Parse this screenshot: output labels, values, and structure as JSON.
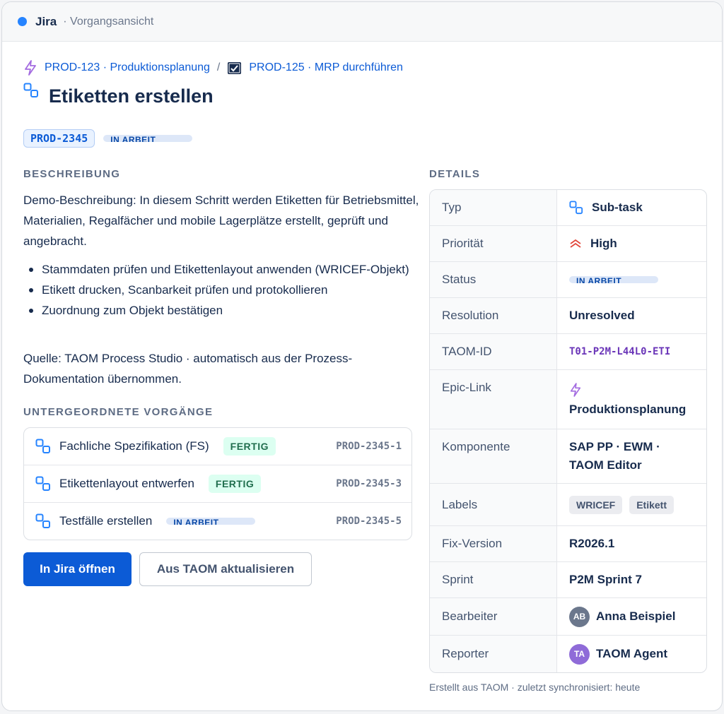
{
  "app": {
    "name": "Jira",
    "view": "· Vorgangsansicht"
  },
  "breadcrumb": {
    "epic": "PROD-123 · Produktionsplanung",
    "separator": "/",
    "parent": "PROD-125 · MRP durchführen"
  },
  "issue": {
    "title": "Etiketten erstellen",
    "key": "PROD-2345",
    "status": "IN ARBEIT"
  },
  "description": {
    "heading": "BESCHREIBUNG",
    "intro": "Demo-Beschreibung: In diesem Schritt werden Etiketten für Betriebsmittel, Materialien, Regalfächer und mobile Lagerplätze erstellt, geprüft und angebracht.",
    "bullets": [
      "Stammdaten prüfen und Etikettenlayout anwenden (WRICEF-Objekt)",
      "Etikett drucken, Scanbarkeit prüfen und protokollieren",
      "Zuordnung zum Objekt bestätigen"
    ],
    "source": "Quelle: TAOM Process Studio · automatisch aus der Prozess-Dokumentation übernommen."
  },
  "subtasks": {
    "heading": "UNTERGEORDNETE VORGÄNGE",
    "items": [
      {
        "name": "Fachliche Spezifikation (FS)",
        "status": "FERTIG",
        "key": "PROD-2345-1"
      },
      {
        "name": "Etikettenlayout entwerfen",
        "status": "FERTIG",
        "key": "PROD-2345-3"
      },
      {
        "name": "Testfälle erstellen",
        "status": "IN ARBEIT",
        "key": "PROD-2345-5"
      }
    ]
  },
  "actions": {
    "open_jira": "In Jira öffnen",
    "refresh": "Aus TAOM aktualisieren"
  },
  "details": {
    "heading": "DETAILS",
    "type": {
      "label": "Typ",
      "value": "Sub-task"
    },
    "priority": {
      "label": "Priorität",
      "value": "High"
    },
    "status": {
      "label": "Status",
      "value": "IN ARBEIT"
    },
    "resolution": {
      "label": "Resolution",
      "value": "Unresolved"
    },
    "taom_id": {
      "label": "TAOM-ID",
      "value": "T01-P2M-L44L0-ETI"
    },
    "epic_link": {
      "label": "Epic-Link",
      "value": "Produktionsplanung"
    },
    "component": {
      "label": "Komponente",
      "value": "SAP PP · EWM · TAOM Editor"
    },
    "labels": {
      "label": "Labels",
      "values": [
        "WRICEF",
        "Etikett"
      ]
    },
    "fix_version": {
      "label": "Fix-Version",
      "value": "R2026.1"
    },
    "sprint": {
      "label": "Sprint",
      "value": "P2M Sprint 7"
    },
    "assignee": {
      "label": "Bearbeiter",
      "initials": "AB",
      "name": "Anna Beispiel"
    },
    "reporter": {
      "label": "Reporter",
      "initials": "TA",
      "name": "TAOM Agent"
    }
  },
  "footer": "Erstellt aus TAOM · zuletzt synchronisiert: heute",
  "colors": {
    "accent": "#0c5bd6",
    "epic": "#8f4dd8",
    "priority": "#e2483d",
    "done": "#216e4e"
  }
}
